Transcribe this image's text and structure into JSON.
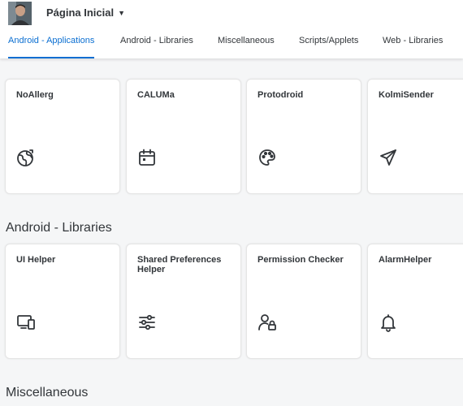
{
  "header": {
    "title": "Página Inicial",
    "tabs": [
      {
        "label": "Android - Applications",
        "active": true
      },
      {
        "label": "Android - Libraries",
        "active": false
      },
      {
        "label": "Miscellaneous",
        "active": false
      },
      {
        "label": "Scripts/Applets",
        "active": false
      },
      {
        "label": "Web - Libraries",
        "active": false
      }
    ]
  },
  "sections": [
    {
      "title": "",
      "cards": [
        {
          "title": "NoAllerg",
          "icon": "globe-icon"
        },
        {
          "title": "CALUMa",
          "icon": "calendar-icon"
        },
        {
          "title": "Protodroid",
          "icon": "palette-icon"
        },
        {
          "title": "KolmiSender",
          "icon": "paper-plane-icon"
        }
      ]
    },
    {
      "title": "Android - Libraries",
      "cards": [
        {
          "title": "UI Helper",
          "icon": "devices-icon"
        },
        {
          "title": "Shared Preferences Helper",
          "icon": "sliders-icon"
        },
        {
          "title": "Permission Checker",
          "icon": "user-lock-icon"
        },
        {
          "title": "AlarmHelper",
          "icon": "bell-icon"
        }
      ]
    },
    {
      "title": "Miscellaneous",
      "cards": []
    }
  ],
  "colors": {
    "accent": "#0a6ed1",
    "icon": "#32363a",
    "background": "#f5f6f7"
  }
}
